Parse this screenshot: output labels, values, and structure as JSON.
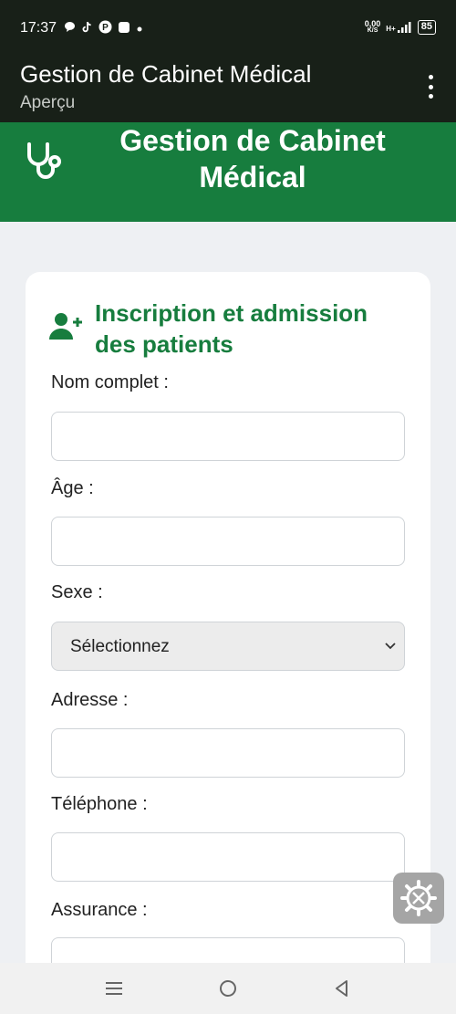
{
  "status_bar": {
    "time": "17:37",
    "net_speed_value": "0,00",
    "net_speed_unit": "K/S",
    "network": "H+",
    "battery": "85",
    "icons": [
      "chat-bubble-icon",
      "tiktok-icon",
      "pinterest-icon",
      "square-app-icon",
      "dot-icon",
      "signal-icon"
    ]
  },
  "app_bar": {
    "title": "Gestion de Cabinet Médical",
    "subtitle": "Aperçu",
    "menu_icon": "more-vert-icon"
  },
  "banner": {
    "title": "Gestion de Cabinet Médical",
    "icon": "stethoscope-icon",
    "color": "#177d3e"
  },
  "form": {
    "heading": "Inscription et admission des patients",
    "heading_icon": "user-plus-icon",
    "fields": {
      "name_label": "Nom complet :",
      "name_value": "",
      "age_label": "Âge :",
      "age_value": "",
      "sex_label": "Sexe :",
      "sex_selected": "Sélectionnez",
      "address_label": "Adresse :",
      "address_value": "",
      "phone_label": "Téléphone :",
      "phone_value": "",
      "insurance_label": "Assurance :",
      "insurance_value": ""
    }
  },
  "floating_button": {
    "icon": "settings-tools-icon"
  },
  "nav_bar": {
    "icons": [
      "recents-icon",
      "home-icon",
      "back-icon"
    ]
  },
  "colors": {
    "accent": "#177d3e",
    "topbar": "#182018",
    "background": "#eef0f3"
  }
}
